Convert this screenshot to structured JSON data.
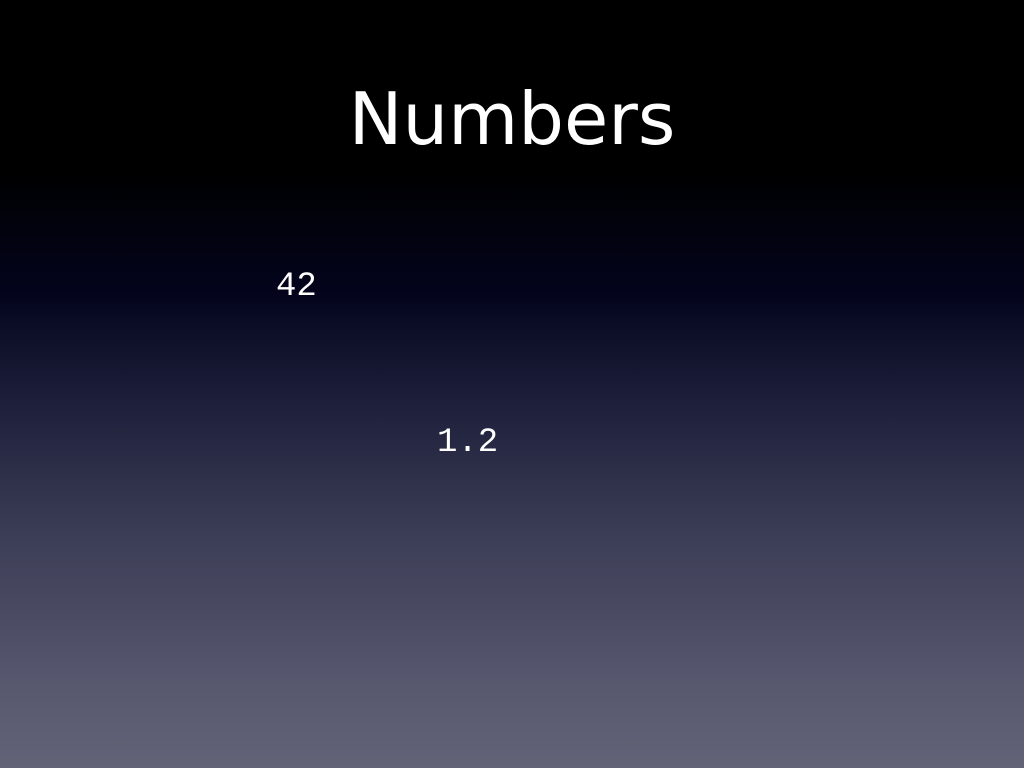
{
  "slide": {
    "title": "Numbers",
    "values": [
      "42",
      "1.2"
    ]
  },
  "colors": {
    "text": "#ffffff",
    "background_top": "#000000",
    "background_mid": "#03041c",
    "background_bottom": "#626377"
  }
}
